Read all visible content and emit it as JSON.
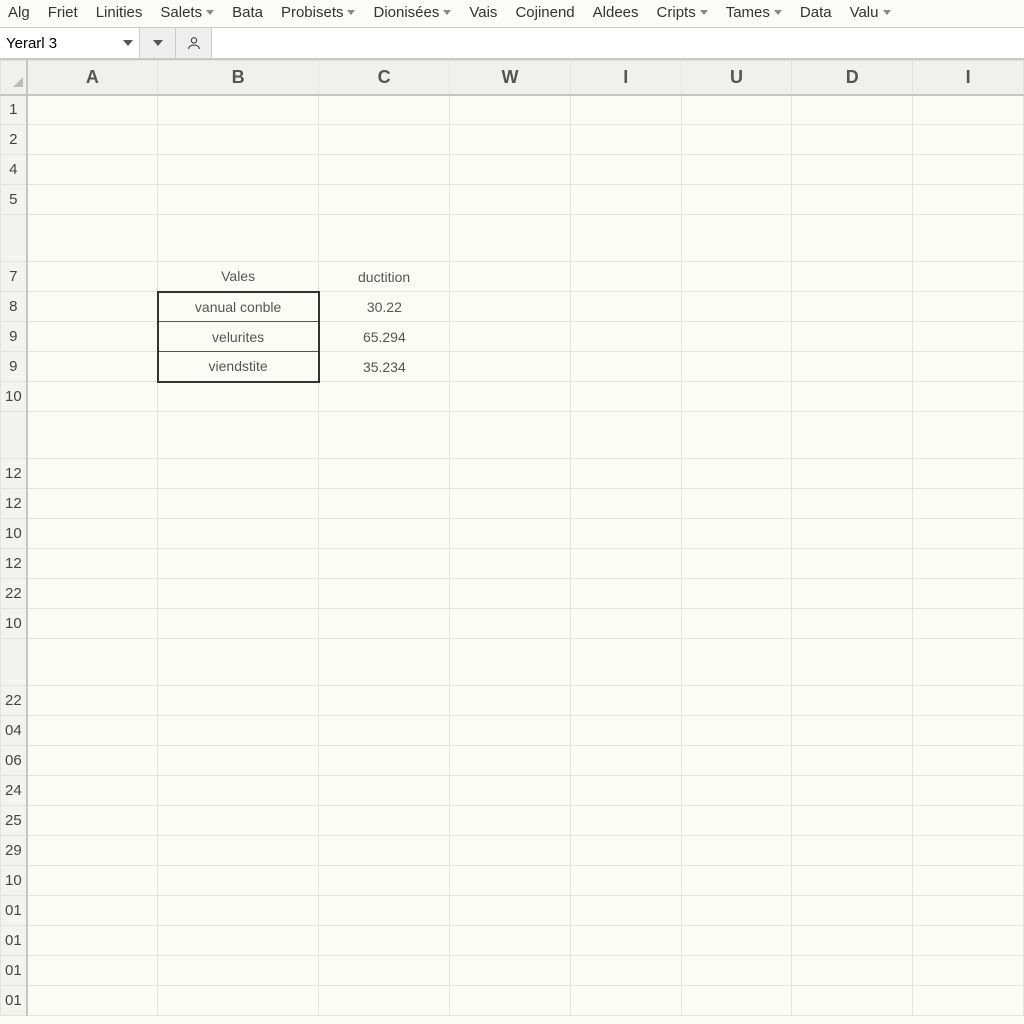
{
  "menu": {
    "items": [
      {
        "label": "Alg",
        "caret": false
      },
      {
        "label": "Friet",
        "caret": false
      },
      {
        "label": "Linities",
        "caret": false
      },
      {
        "label": "Salets",
        "caret": true
      },
      {
        "label": "Bata",
        "caret": false
      },
      {
        "label": "Probisets",
        "caret": true
      },
      {
        "label": "Dionisées",
        "caret": true
      },
      {
        "label": "Vais",
        "caret": false
      },
      {
        "label": "Cojinend",
        "caret": false
      },
      {
        "label": "Aldees",
        "caret": false
      },
      {
        "label": "Cripts",
        "caret": true
      },
      {
        "label": "Tames",
        "caret": true
      },
      {
        "label": "Data",
        "caret": false
      },
      {
        "label": "Valu",
        "caret": true
      }
    ]
  },
  "namebox": {
    "value": "Yerarl 3"
  },
  "columns": [
    "A",
    "B",
    "C",
    "W",
    "I",
    "U",
    "D",
    "I"
  ],
  "rows": [
    "1",
    "2",
    "4",
    "5",
    "",
    "7",
    "8",
    "9",
    "9",
    "10",
    "",
    "12",
    "12",
    "10",
    "12",
    "22",
    "10",
    "",
    "22",
    "04",
    "06",
    "24",
    "25",
    "29",
    "10",
    "01",
    "01",
    "01",
    "01"
  ],
  "table": {
    "header": {
      "b": "Vales",
      "c": "ductition"
    },
    "data": [
      {
        "b": "vanual conble",
        "c": "30.22"
      },
      {
        "b": "velurites",
        "c": "65.294"
      },
      {
        "b": "viendstite",
        "c": "35.234"
      }
    ]
  },
  "chart_data": {
    "type": "table",
    "title": "",
    "columns": [
      "Vales",
      "ductition"
    ],
    "rows": [
      [
        "vanual conble",
        30.22
      ],
      [
        "velurites",
        65.294
      ],
      [
        "viendstite",
        35.234
      ]
    ]
  }
}
